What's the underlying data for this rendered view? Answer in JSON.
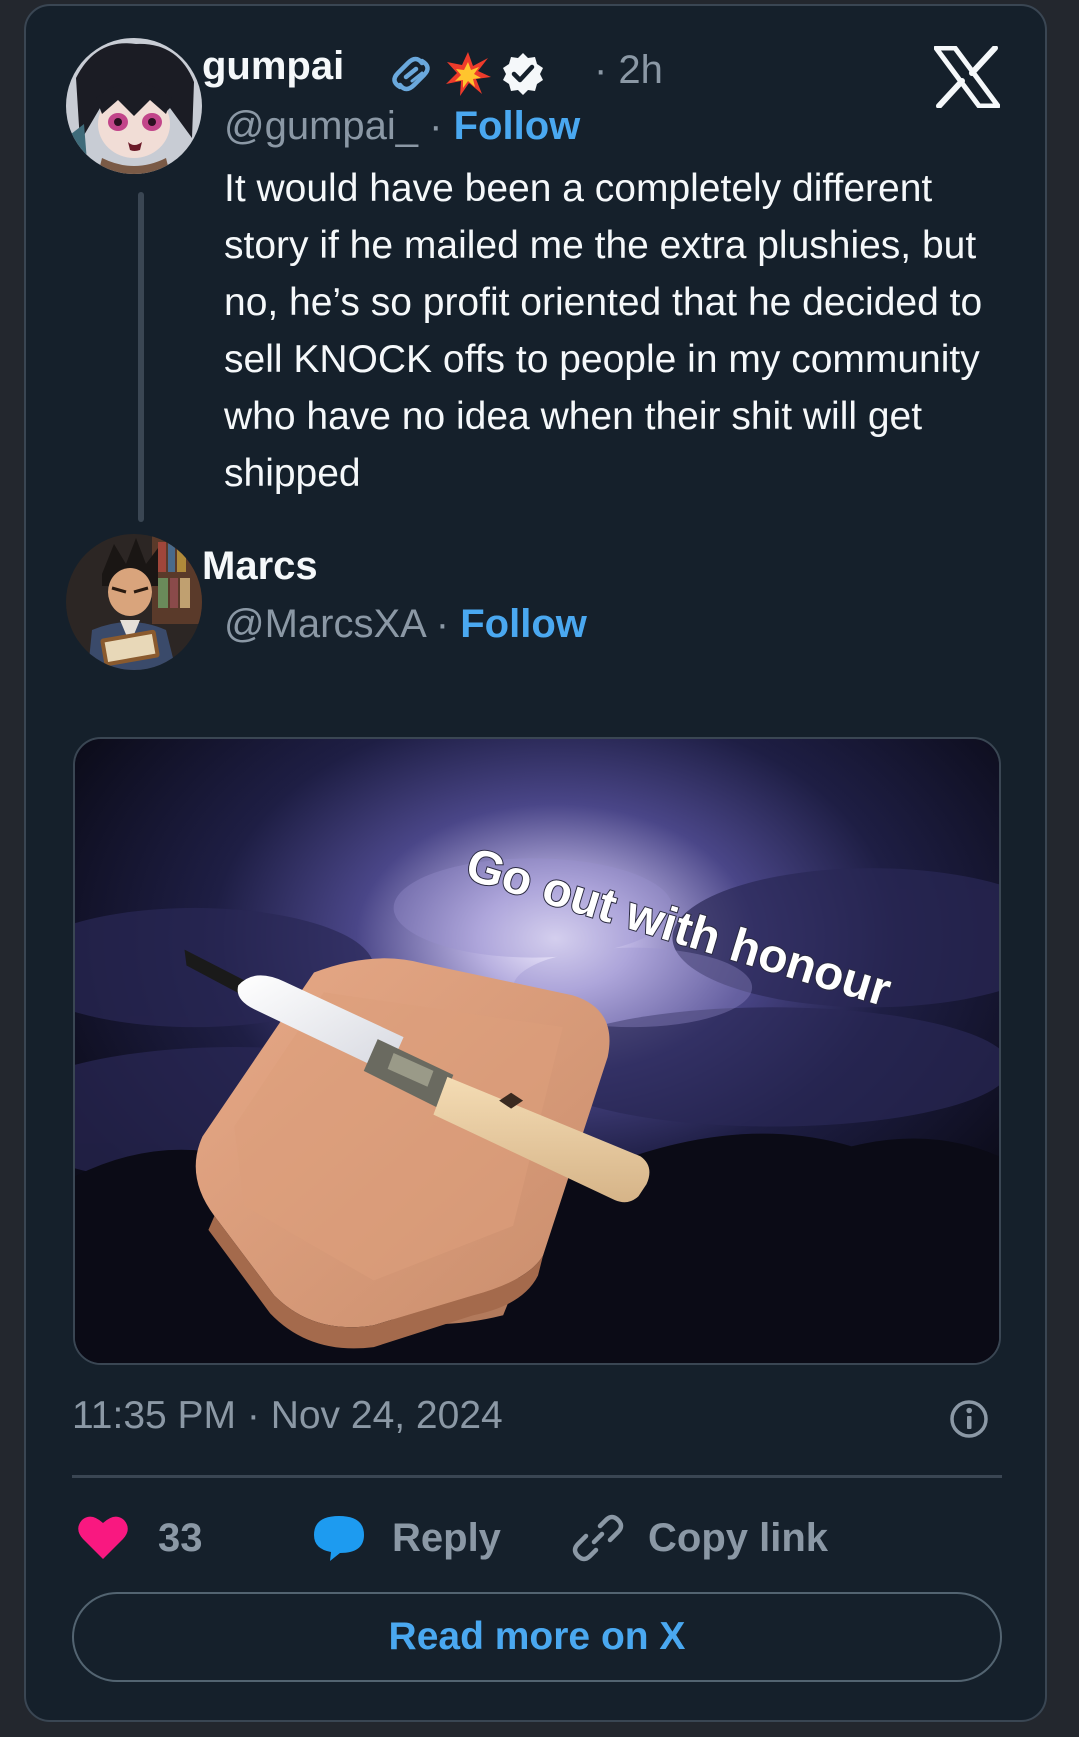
{
  "tweet": {
    "author": {
      "name": "gumpai",
      "handle": "@gumpai_",
      "separator": "·",
      "follow_label": "Follow",
      "time": "· 2h"
    },
    "text": "It would have been a completely different story if he mailed me the extra plushies, but no, he’s so profit oriented that he decided to sell KNOCK offs to people in my community who have no idea when their shit will get shipped"
  },
  "reply": {
    "author": {
      "name": "Marcs",
      "handle": "@MarcsXA",
      "separator": "·",
      "follow_label": "Follow"
    },
    "media": {
      "caption_text": "Go out with honour"
    },
    "timestamp": "11:35 PM · Nov 24, 2024"
  },
  "actions": {
    "likes_count": "33",
    "reply_label": "Reply",
    "copy_link_label": "Copy link"
  },
  "read_more_label": "Read more on X",
  "colors": {
    "background": "#15202b",
    "accent": "#4aa8f0",
    "like": "#f91880",
    "muted": "#8b98a5"
  },
  "icons": [
    "link-chain-icon",
    "collision-emoji-icon",
    "verified-badge-icon",
    "x-logo-icon",
    "info-icon",
    "heart-icon",
    "speech-bubble-icon",
    "copy-link-icon"
  ]
}
